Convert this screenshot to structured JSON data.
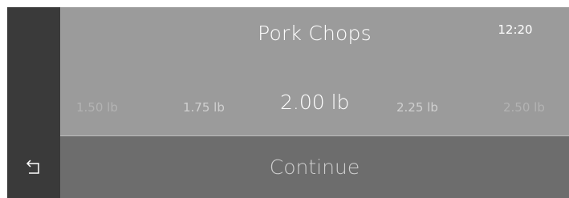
{
  "header": {
    "title": "Pork Chops",
    "time": "12:20"
  },
  "weight_selector": {
    "options": [
      "1.50 lb",
      "1.75 lb",
      "2.00 lb",
      "2.25 lb",
      "2.50 lb"
    ],
    "selected": "2.00 lb"
  },
  "footer": {
    "continue_label": "Continue"
  },
  "sidebar": {
    "back_icon": "back-arrow-icon"
  },
  "colors": {
    "sidebar": "#3a3a3a",
    "panel": "#9b9b9b",
    "footer": "#6d6d6d",
    "text": "#ffffff"
  }
}
